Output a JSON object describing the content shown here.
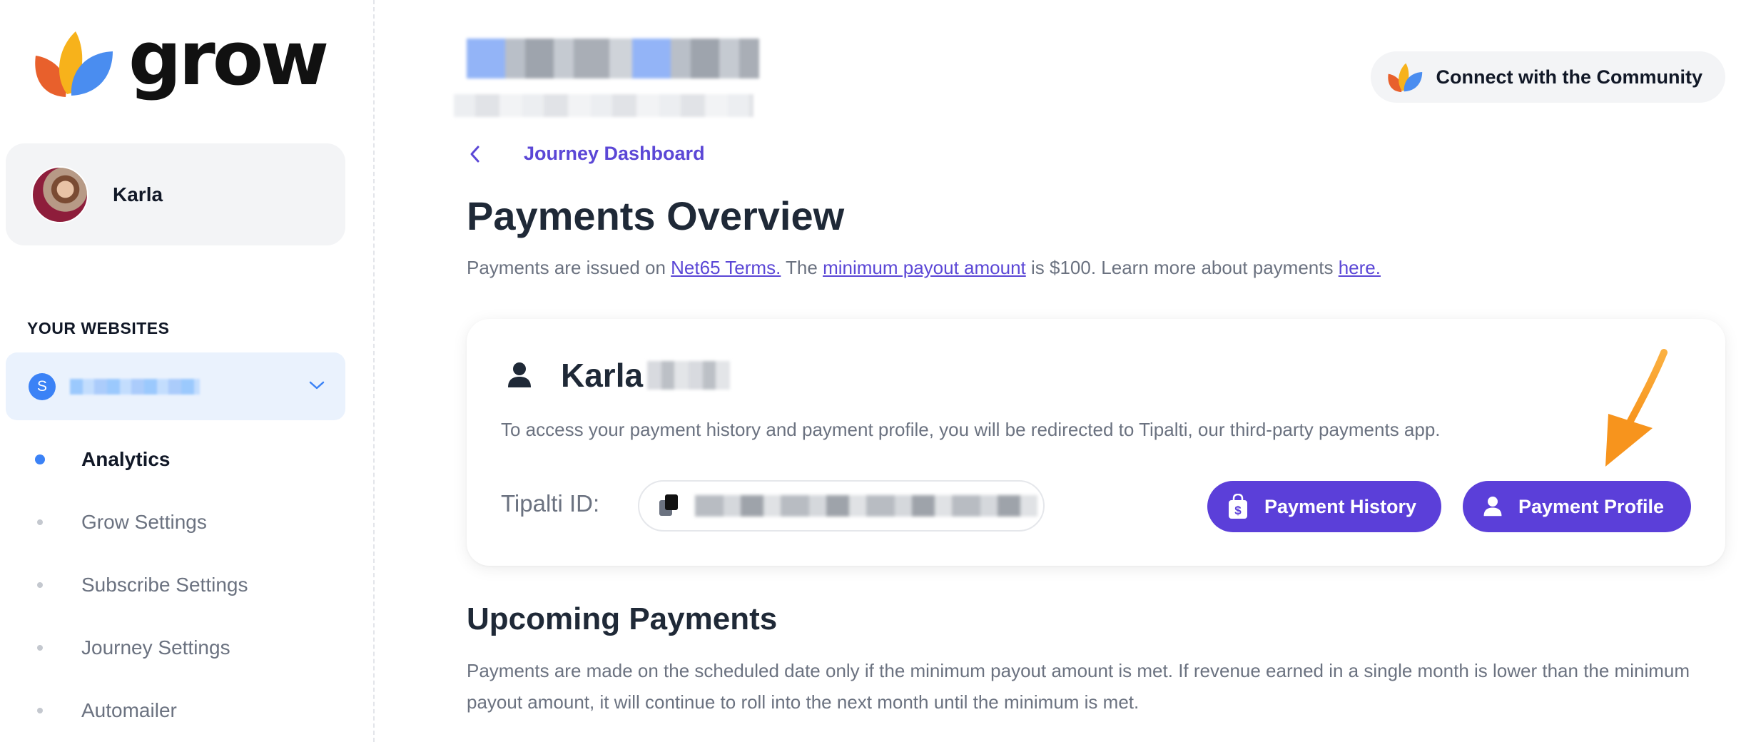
{
  "brand": {
    "name": "grow"
  },
  "user": {
    "name": "Karla"
  },
  "sidebar": {
    "section_label": "YOUR WEBSITES",
    "site_badge": "S",
    "nav": [
      {
        "label": "Analytics",
        "active": true
      },
      {
        "label": "Grow Settings",
        "active": false
      },
      {
        "label": "Subscribe Settings",
        "active": false
      },
      {
        "label": "Journey Settings",
        "active": false
      },
      {
        "label": "Automailer",
        "active": false
      }
    ]
  },
  "header": {
    "community_button": "Connect with the Community"
  },
  "breadcrumb": {
    "label": "Journey Dashboard"
  },
  "page": {
    "title": "Payments Overview",
    "intro_1": "Payments are issued on ",
    "intro_link_1": "Net65 Terms.",
    "intro_2": " The ",
    "intro_link_2": "minimum payout amount",
    "intro_3": " is $100. Learn more about payments ",
    "intro_link_3": "here."
  },
  "card": {
    "name": "Karla",
    "description": "To access your payment history and payment profile, you will be redirected to Tipalti, our third-party payments app.",
    "tipalti_label": "Tipalti ID:",
    "history_button": "Payment History",
    "profile_button": "Payment Profile"
  },
  "upcoming": {
    "title": "Upcoming Payments",
    "description": "Payments are made on the scheduled date only if the minimum payout amount is met. If revenue earned in a single month is lower than the minimum payout amount, it will continue to roll into the next month until the minimum is met."
  },
  "colors": {
    "accent": "#5b3fd9",
    "link": "#5b47d6",
    "arrow": "#f7941d",
    "site_badge": "#3b82f6"
  }
}
